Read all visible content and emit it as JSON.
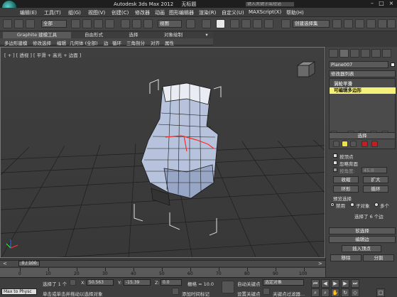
{
  "app": {
    "title": "Autodesk 3ds Max  2012",
    "doc_title": "无标题",
    "search_placeholder": "键入关键字或短语"
  },
  "menu": [
    "编辑(E)",
    "工具(T)",
    "组(G)",
    "视图(V)",
    "创建(C)",
    "修改器",
    "动画",
    "图形编辑器",
    "渲染(R)",
    "自定义(U)",
    "MAXScript(X)",
    "帮助(H)"
  ],
  "toolbar": {
    "filter": "全部",
    "refcoord": "视图",
    "named_sel": "创建选择集"
  },
  "ribbon": {
    "tabs": [
      "Graphite 建模工具",
      "自由形式",
      "选择",
      "对象绘制"
    ],
    "subitems": [
      "多边形建模",
      "修改选择",
      "编辑",
      "几何体 (全部)",
      "边",
      "循环",
      "三角剖分",
      "对齐",
      "属性"
    ]
  },
  "viewport": {
    "label": "[ + ] [ 透视 ] [ 平滑 + 高光 + 边面 ]"
  },
  "command_panel": {
    "object_name": "Plane007",
    "modifier_list": "修改器列表",
    "stack": [
      {
        "label": "涡轮平滑",
        "selected": false
      },
      {
        "label": "可编辑多边形",
        "selected": true
      }
    ],
    "rollout_selection": "选择",
    "by_vertex": "按顶点",
    "ignore_backface": "忽略背面",
    "by_angle": "按角度:",
    "angle_value": "45.0",
    "shrink": "收缩",
    "grow": "扩大",
    "ring": "环形",
    "loop": "循环",
    "preview_sel": "预览选择",
    "preview_off": "禁用",
    "preview_subobj": "子对象",
    "preview_multi": "多个",
    "selected_count": "选择了 6 个边",
    "rollout_soft": "软选择",
    "rollout_edit_edges": "编辑边",
    "insert_vertex": "插入顶点",
    "remove": "移除",
    "split": "分割"
  },
  "timeline": {
    "frame_display": "0 / 100",
    "ticks": [
      "0",
      "10",
      "20",
      "30",
      "40",
      "50",
      "60",
      "70",
      "80",
      "90",
      "100"
    ]
  },
  "status": {
    "script_label": "Max to Physc",
    "selected": "选择了 1 个",
    "prompt": "单击或单击并拖动以选择对象",
    "x_label": "X:",
    "x_value": "50.563",
    "y_label": "Y:",
    "y_value": "-15.39",
    "z_label": "Z:",
    "z_value": "0.0",
    "grid": "栅格 = 10.0",
    "add_time_tag": "添加时间标记",
    "auto_key": "自动关键点",
    "set_key": "设置关键点",
    "sel_object": "选定对象",
    "key_filters": "关键点过滤器..."
  },
  "colors": {
    "accent_yellow": "#f0e050",
    "stack_selected_bg": "#f5f07a",
    "edge_red": "#ff2a2a"
  }
}
